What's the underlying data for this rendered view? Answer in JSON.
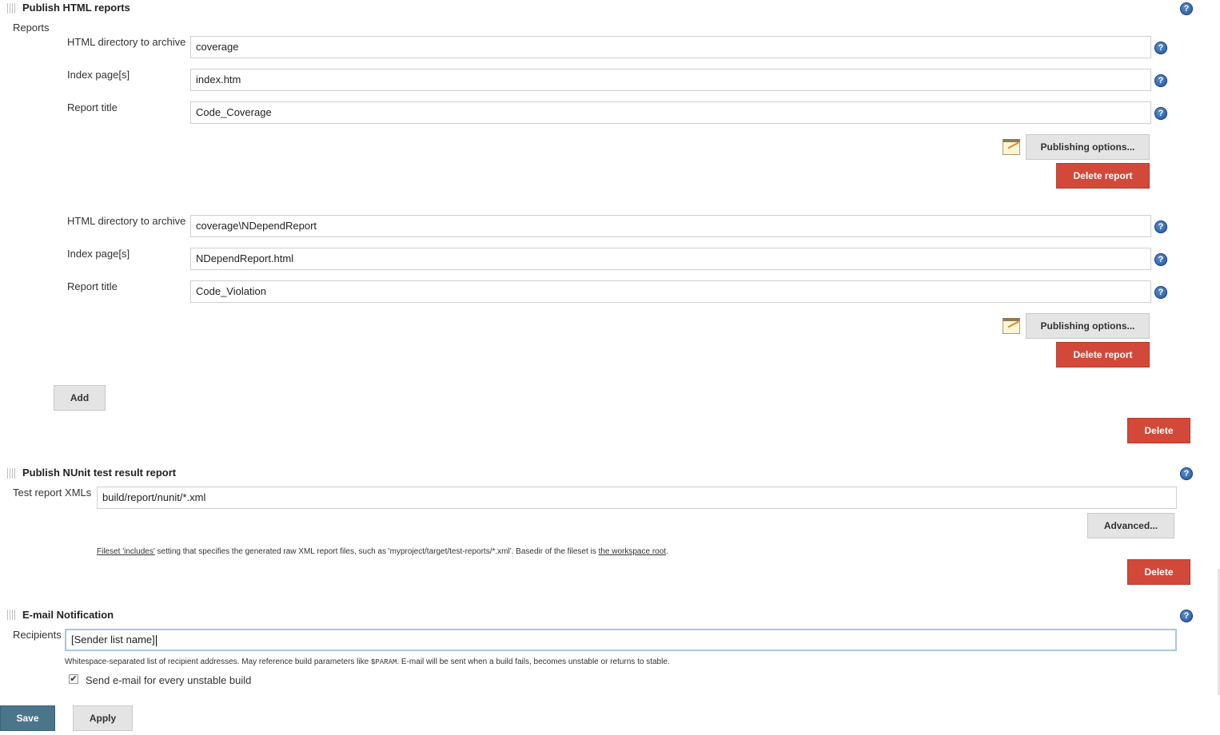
{
  "html_reports": {
    "title": "Publish HTML reports",
    "reports_label": "Reports",
    "reports": [
      {
        "dir_label": "HTML directory to archive",
        "dir_value": "coverage",
        "index_label": "Index page[s]",
        "index_value": "index.htm",
        "title_label": "Report title",
        "title_value": "Code_Coverage",
        "publishing_options": "Publishing options...",
        "delete_report": "Delete report"
      },
      {
        "dir_label": "HTML directory to archive",
        "dir_value": "coverage\\NDependReport",
        "index_label": "Index page[s]",
        "index_value": "NDependReport.html",
        "title_label": "Report title",
        "title_value": "Code_Violation",
        "publishing_options": "Publishing options...",
        "delete_report": "Delete report"
      }
    ],
    "add_label": "Add",
    "delete_label": "Delete"
  },
  "nunit": {
    "title": "Publish NUnit test result report",
    "xml_label": "Test report XMLs",
    "xml_value": "build/report/nunit/*.xml",
    "advanced_label": "Advanced...",
    "desc_link1": "Fileset 'includes'",
    "desc_text1": " setting that specifies the generated raw XML report files, such as 'myproject/target/test-reports/*.xml'. Basedir of the fileset is ",
    "desc_link2": "the workspace root",
    "desc_text2": ".",
    "delete_label": "Delete"
  },
  "email": {
    "title": "E-mail Notification",
    "recipients_label": "Recipients",
    "recipients_value": "[Sender list name]",
    "desc_text1": "Whitespace-separated list of recipient addresses. May reference build parameters like ",
    "desc_param": "$PARAM",
    "desc_text2": ". E-mail will be sent when a build fails, becomes unstable or returns to stable.",
    "unstable_label": "Send e-mail for every unstable build",
    "unstable_checked": true
  },
  "footer": {
    "save_label": "Save",
    "apply_label": "Apply"
  },
  "icons": {
    "help": "help-icon",
    "drag": "drag-handle-icon",
    "notepad": "notepad-icon"
  }
}
